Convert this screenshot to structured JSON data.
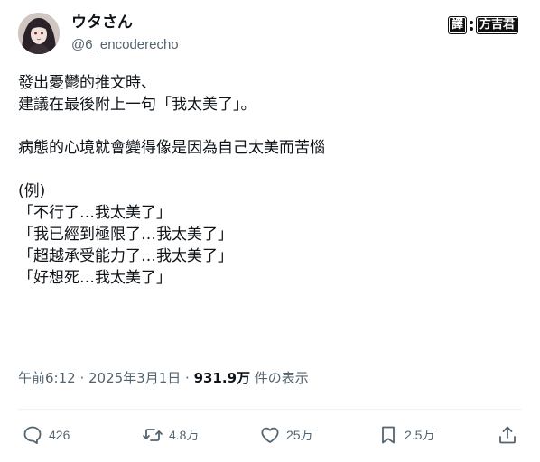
{
  "author": {
    "name": "ウタさん",
    "handle": "@6_encoderecho"
  },
  "watermark": {
    "label_left": "譯",
    "label_right": "方吉君"
  },
  "post": {
    "lines": [
      "發出憂鬱的推文時、",
      "建議在最後附上一句「我太美了」。",
      "",
      "病態的心境就會變得像是因為自己太美而苦惱",
      "",
      " (例)",
      "「不行了…我太美了」",
      "「我已經到極限了…我太美了」",
      "「超越承受能力了…我太美了」",
      "「好想死…我太美了」"
    ]
  },
  "meta": {
    "timestamp": "午前6:12 · 2025年3月1日 · ",
    "views_count": "931.9万",
    "views_label": " 件の表示"
  },
  "actions": {
    "replies": "426",
    "reposts": "4.8万",
    "likes": "25万",
    "bookmarks": "2.5万"
  },
  "icons": {
    "reply": "reply-icon",
    "repost": "repost-icon",
    "like": "heart-icon",
    "bookmark": "bookmark-icon",
    "share": "share-icon"
  },
  "colors": {
    "text": "#0f1419",
    "secondary": "#536471",
    "divider": "#eff3f4"
  }
}
